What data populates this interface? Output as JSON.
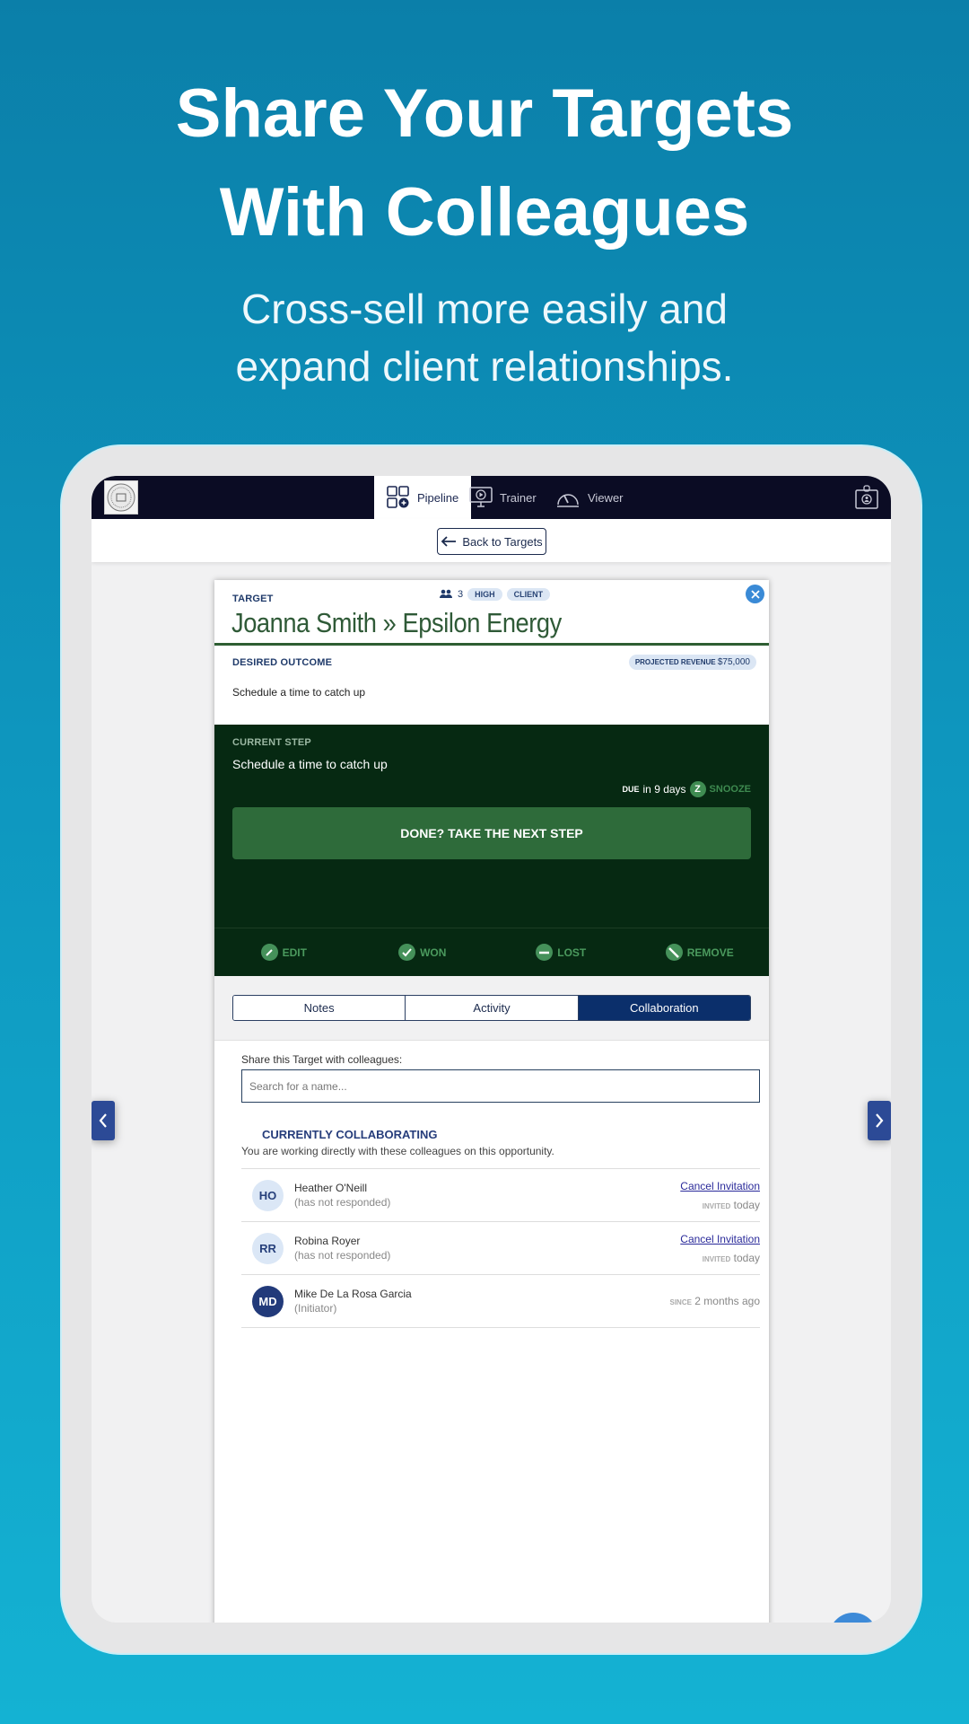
{
  "hero": {
    "title_line1": "Share Your Targets",
    "title_line2": "With Colleagues",
    "subtitle_line1": "Cross-sell more easily and",
    "subtitle_line2": "expand client relationships."
  },
  "app": {
    "nav": {
      "logo": "seal-logo",
      "tabs": [
        {
          "label": "Pipeline",
          "icon": "pipeline-grid-icon",
          "active": true
        },
        {
          "label": "Trainer",
          "icon": "monitor-play-icon",
          "active": false
        },
        {
          "label": "Viewer",
          "icon": "speedometer-icon",
          "active": false
        }
      ],
      "profile_icon": "id-badge-icon"
    },
    "back_button": "Back to Targets",
    "target": {
      "label": "TARGET",
      "title": "Joanna Smith » Epsilon Energy",
      "people_count": "3",
      "pills": [
        "HIGH",
        "CLIENT"
      ],
      "close_icon": "close-icon"
    },
    "desired_outcome": {
      "label": "DESIRED OUTCOME",
      "revenue_label": "PROJECTED REVENUE",
      "revenue_value": "$75,000",
      "text": "Schedule a time to catch up"
    },
    "current_step": {
      "label": "CURRENT STEP",
      "text": "Schedule a time to catch up",
      "due_label": "DUE",
      "due_value": "in 9 days",
      "snooze_label": "SNOOZE",
      "next_button": "DONE? TAKE THE NEXT STEP"
    },
    "actions": [
      {
        "label": "EDIT",
        "icon": "pencil-icon"
      },
      {
        "label": "WON",
        "icon": "check-icon"
      },
      {
        "label": "LOST",
        "icon": "minus-icon"
      },
      {
        "label": "REMOVE",
        "icon": "slash-icon"
      }
    ],
    "tabs": [
      {
        "label": "Notes",
        "active": false
      },
      {
        "label": "Activity",
        "active": false
      },
      {
        "label": "Collaboration",
        "active": true
      }
    ],
    "collaboration": {
      "share_label": "Share this Target with colleagues:",
      "search_placeholder": "Search for a name...",
      "section_title": "CURRENTLY COLLABORATING",
      "section_sub": "You are working directly with these colleagues on this opportunity.",
      "people": [
        {
          "initials": "HO",
          "name": "Heather O'Neill",
          "status": "(has not responded)",
          "action": "Cancel Invitation",
          "meta_label": "INVITED",
          "meta_value": "today"
        },
        {
          "initials": "RR",
          "name": "Robina Royer",
          "status": "(has not responded)",
          "action": "Cancel Invitation",
          "meta_label": "INVITED",
          "meta_value": "today"
        },
        {
          "initials": "MD",
          "name": "Mike De La Rosa Garcia",
          "status": "(Initiator)",
          "action": "",
          "meta_label": "SINCE",
          "meta_value": "2 months ago"
        }
      ]
    }
  }
}
